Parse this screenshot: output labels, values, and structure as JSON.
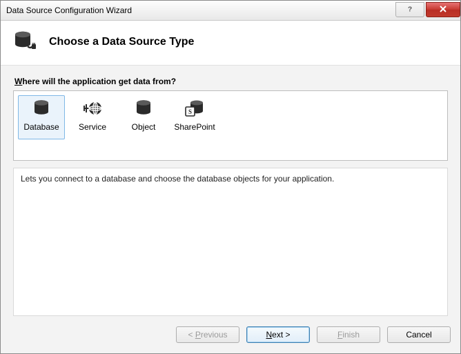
{
  "titlebar": {
    "title": "Data Source Configuration Wizard"
  },
  "header": {
    "heading": "Choose a Data Source Type"
  },
  "body": {
    "prompt_pre": "",
    "prompt_ul": "W",
    "prompt_post": "here will the application get data from?",
    "options": {
      "database": {
        "label": "Database",
        "selected": true
      },
      "service": {
        "label": "Service",
        "selected": false
      },
      "object": {
        "label": "Object",
        "selected": false
      },
      "sharepoint": {
        "label": "SharePoint",
        "selected": false
      }
    },
    "description": "Lets you connect to a database and choose the database objects for your application."
  },
  "footer": {
    "previous_pre": "< ",
    "previous_mn": "P",
    "previous_post": "revious",
    "next_mn": "N",
    "next_post": "ext >",
    "finish_pre": "",
    "finish_mn": "F",
    "finish_post": "inish",
    "cancel": "Cancel"
  }
}
